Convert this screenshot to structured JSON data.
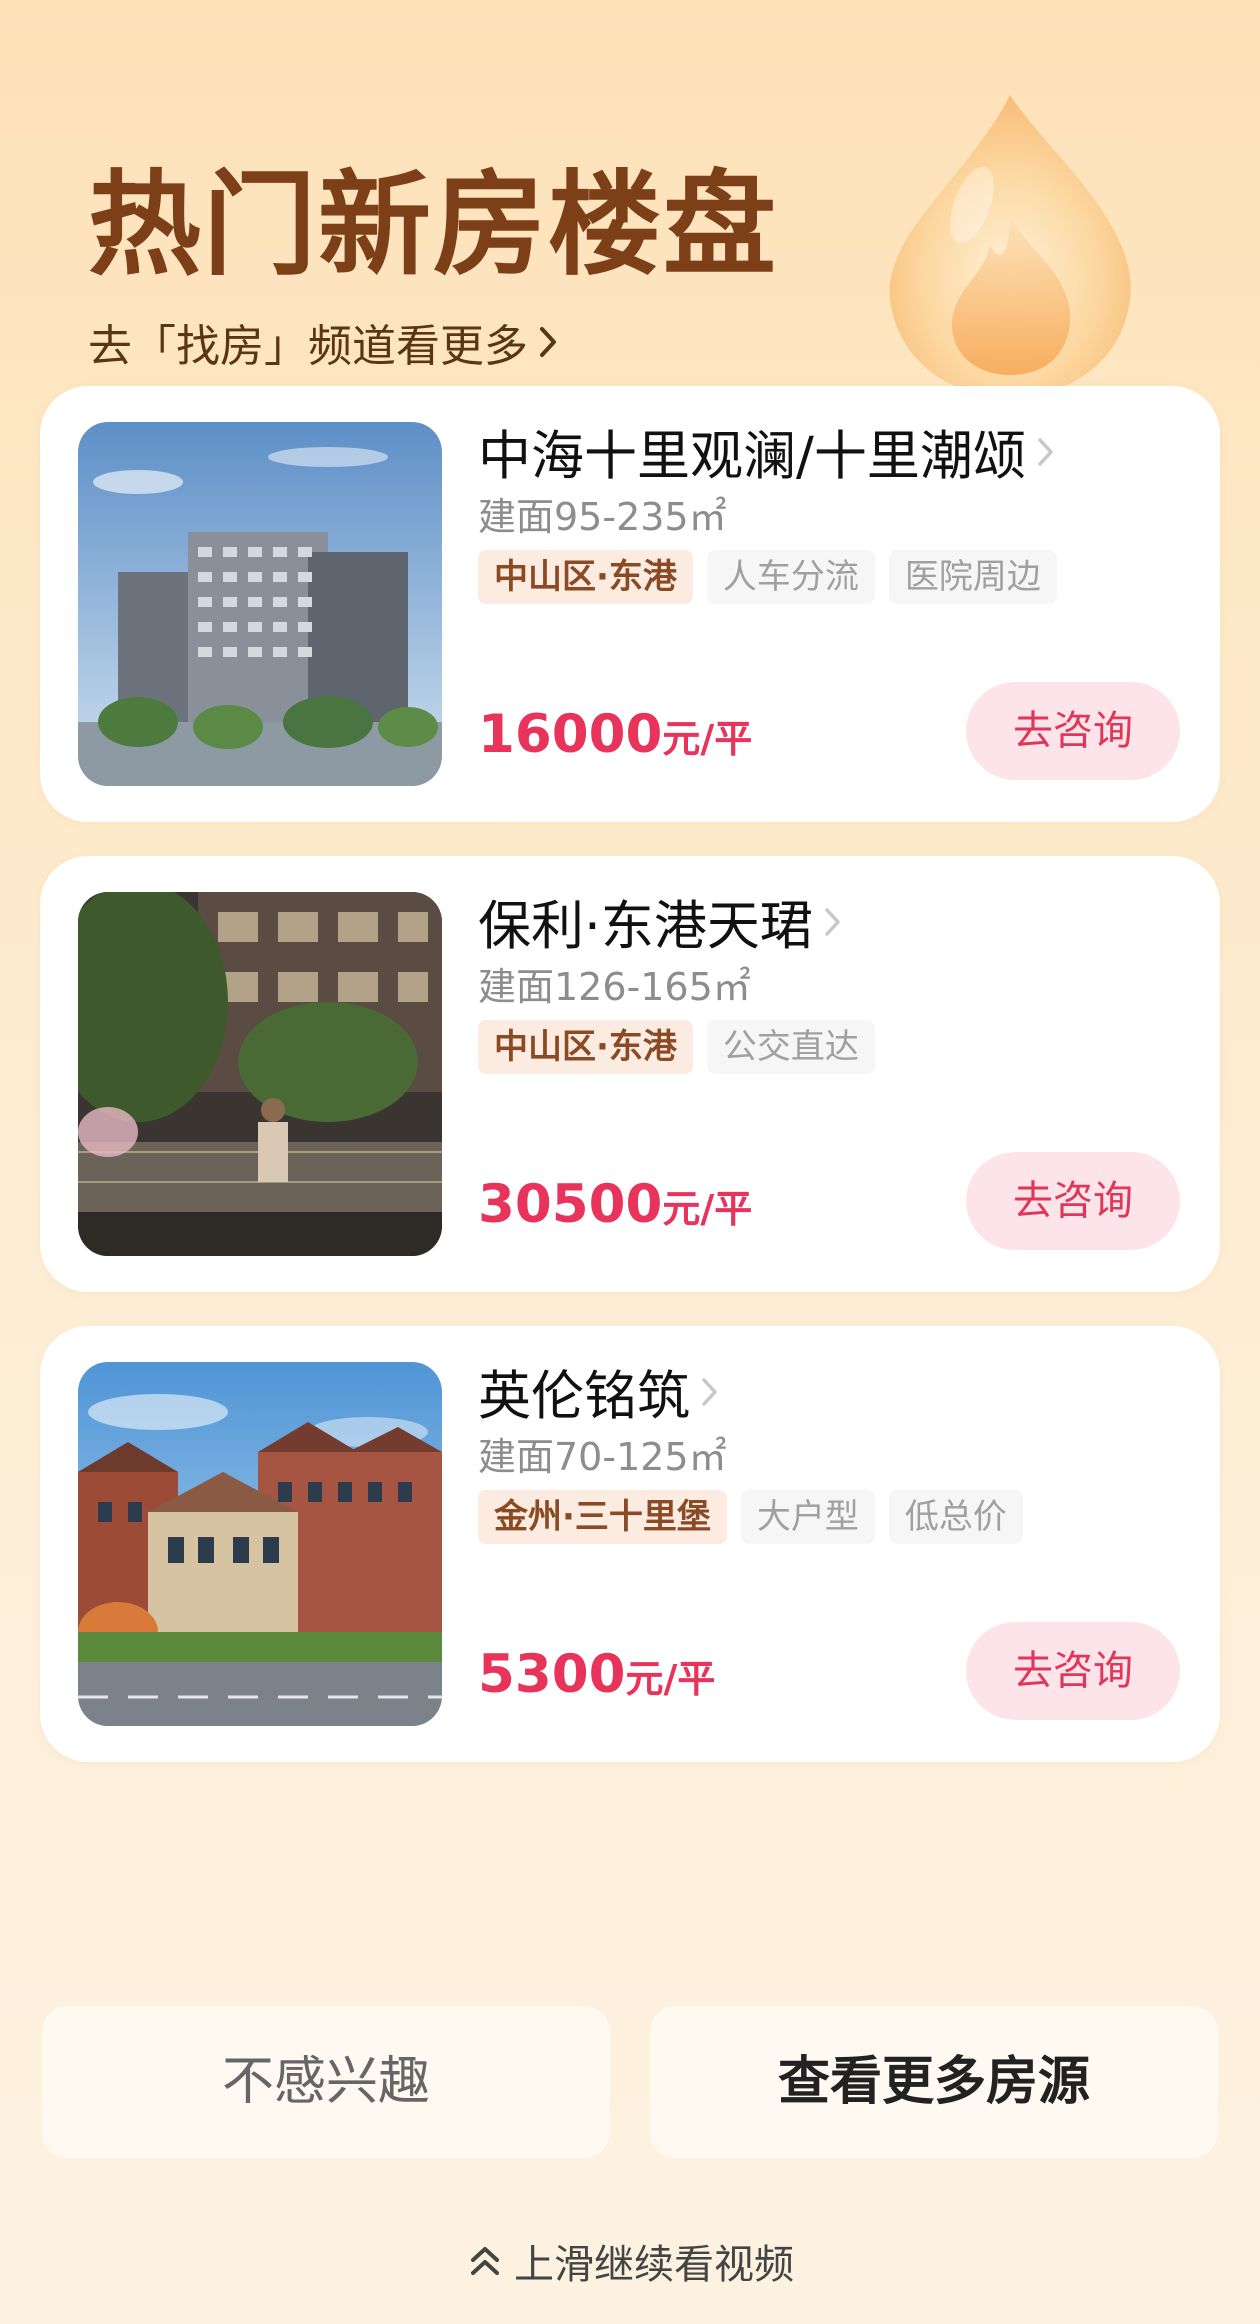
{
  "header": {
    "title": "热门新房楼盘",
    "subtitle_link": "去「找房」频道看更多"
  },
  "listings": [
    {
      "name": "中海十里观澜/十里潮颂",
      "area": "建面95-235㎡",
      "location_tag": "中山区·东港",
      "tags": [
        "人车分流",
        "医院周边"
      ],
      "price": "16000",
      "price_unit": "元/平",
      "button": "去咨询"
    },
    {
      "name": "保利·东港天珺",
      "area": "建面126-165㎡",
      "location_tag": "中山区·东港",
      "tags": [
        "公交直达"
      ],
      "price": "30500",
      "price_unit": "元/平",
      "button": "去咨询"
    },
    {
      "name": "英伦铭筑",
      "area": "建面70-125㎡",
      "location_tag": "金州·三十里堡",
      "tags": [
        "大户型",
        "低总价"
      ],
      "price": "5300",
      "price_unit": "元/平",
      "button": "去咨询"
    }
  ],
  "actions": {
    "not_interested": "不感兴趣",
    "view_more": "查看更多房源"
  },
  "swipe_hint": "上滑继续看视频",
  "colors": {
    "title_brown": "#7c3f17",
    "price_red": "#e8335b",
    "consult_bg": "#fde4ea",
    "location_tag_bg": "#fcebe1"
  },
  "icons": [
    "flame-icon",
    "chevron-right-icon",
    "chevron-up-double-icon"
  ]
}
